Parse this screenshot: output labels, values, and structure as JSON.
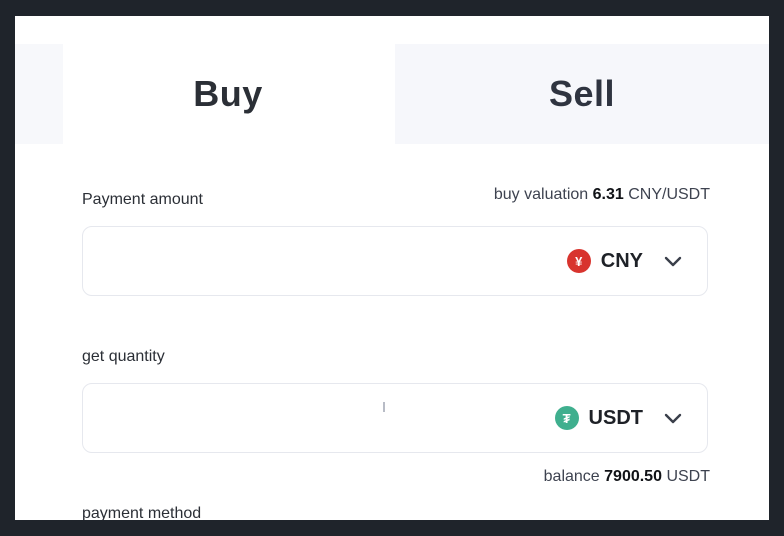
{
  "tabs": {
    "buy": "Buy",
    "sell": "Sell"
  },
  "payment_amount": {
    "label": "Payment amount",
    "value": "",
    "currency": "CNY",
    "currency_icon": "yuan-coin-icon",
    "icon_glyph": "¥"
  },
  "valuation": {
    "prefix": "buy valuation",
    "value": "6.31",
    "unit": "CNY/USDT"
  },
  "get_quantity": {
    "label": "get quantity",
    "value": "",
    "currency": "USDT",
    "currency_icon": "tether-coin-icon",
    "icon_glyph": "₮"
  },
  "balance": {
    "prefix": "balance",
    "value": "7900.50",
    "unit": "USDT"
  },
  "payment_method": {
    "label": "payment method"
  },
  "colors": {
    "active_tab_bg": "#ffffff",
    "inactive_tab_bg": "#f6f7fb",
    "cny_coin": "#d8342e",
    "usdt_coin": "#3faf8e",
    "text_primary": "#2b2f36"
  }
}
